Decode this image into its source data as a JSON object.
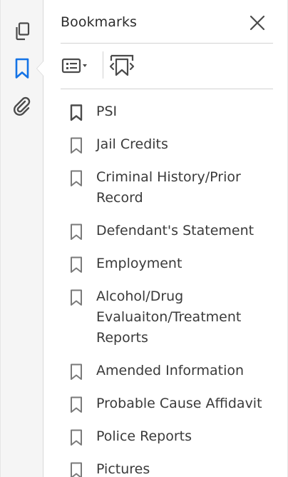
{
  "panel": {
    "title": "Bookmarks"
  },
  "rail": {
    "items": [
      {
        "name": "pages",
        "icon": "pages-icon"
      },
      {
        "name": "bookmarks",
        "icon": "bookmark-icon",
        "active": true
      },
      {
        "name": "attachments",
        "icon": "paperclip-icon"
      }
    ]
  },
  "toolbar": {
    "options_icon": "list-options-icon",
    "expand_icon": "expand-bookmark-icon"
  },
  "bookmarks": [
    {
      "label": "PSI",
      "selected": true
    },
    {
      "label": "Jail Credits"
    },
    {
      "label": "Criminal History/Prior Record"
    },
    {
      "label": "Defendant's Statement"
    },
    {
      "label": "Employment"
    },
    {
      "label": "Alcohol/Drug Evaluaiton/Treatment Reports"
    },
    {
      "label": "Amended Information"
    },
    {
      "label": "Probable Cause Affidavit"
    },
    {
      "label": "Police Reports"
    },
    {
      "label": "Pictures"
    }
  ],
  "colors": {
    "accent": "#1473e6",
    "icon": "#4b4b4b",
    "text": "#3a3a3a",
    "rail_bg": "#f5f5f5"
  }
}
